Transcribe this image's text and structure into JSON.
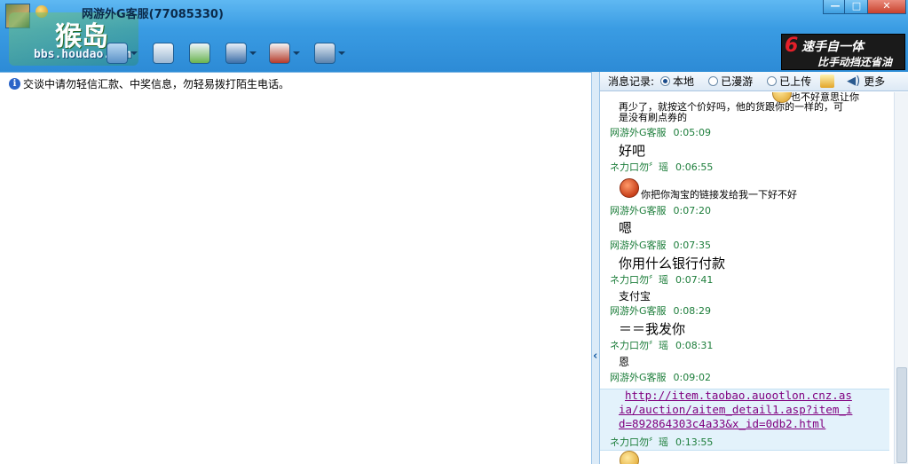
{
  "window": {
    "title": "网游外G客服(77085330)",
    "minimize": "—",
    "maximize": "□",
    "close": "✕"
  },
  "watermark": {
    "name": "猴岛",
    "url": "bbs.houdao.com"
  },
  "ad": {
    "number": "6",
    "line1": "速手自一体",
    "line2": "比手动挡还省油"
  },
  "notice": {
    "icon": "i",
    "text": "交谈中请勿轻信汇款、中奖信息，勿轻易拨打陌生电话。"
  },
  "history_bar": {
    "label": "消息记录:",
    "options": [
      "本地",
      "已漫游",
      "已上传"
    ],
    "selected": "本地",
    "more": "更多"
  },
  "history": {
    "cut_top_text": "也不好意思让你",
    "prev_text_line1": "再少了，就按这个价好吗，他的货跟你的一样的，可",
    "prev_text_line2": "是没有刷点券的",
    "messages": [
      {
        "sender": "网游外G客服",
        "time": "0:05:09",
        "text": "好吧"
      },
      {
        "sender": "ネ力口勿〞瑶",
        "time": "0:06:55",
        "text": "你把你淘宝的链接发给我一下好不好"
      },
      {
        "sender": "网游外G客服",
        "time": "0:07:20",
        "text": "嗯"
      },
      {
        "sender": "网游外G客服",
        "time": "0:07:35",
        "text": "你用什么银行付款"
      },
      {
        "sender": "ネ力口勿〞瑶",
        "time": "0:07:41",
        "text": "支付宝"
      },
      {
        "sender": "网游外G客服",
        "time": "0:08:29",
        "text": "＝＝我发你"
      },
      {
        "sender": "ネ力口勿〞瑶",
        "time": "0:08:31",
        "text": "恩"
      },
      {
        "sender": "网游外G客服",
        "time": "0:09:02",
        "link_lines": [
          "http://item.taobao.auootlon.cnz.as",
          "ia/auction/aitem_detail1.asp?item_i",
          "d=892864303c4a33&x_id=0db2.html"
        ]
      },
      {
        "sender": "ネ力口勿〞瑶",
        "time": "0:13:55",
        "text": ""
      }
    ]
  }
}
